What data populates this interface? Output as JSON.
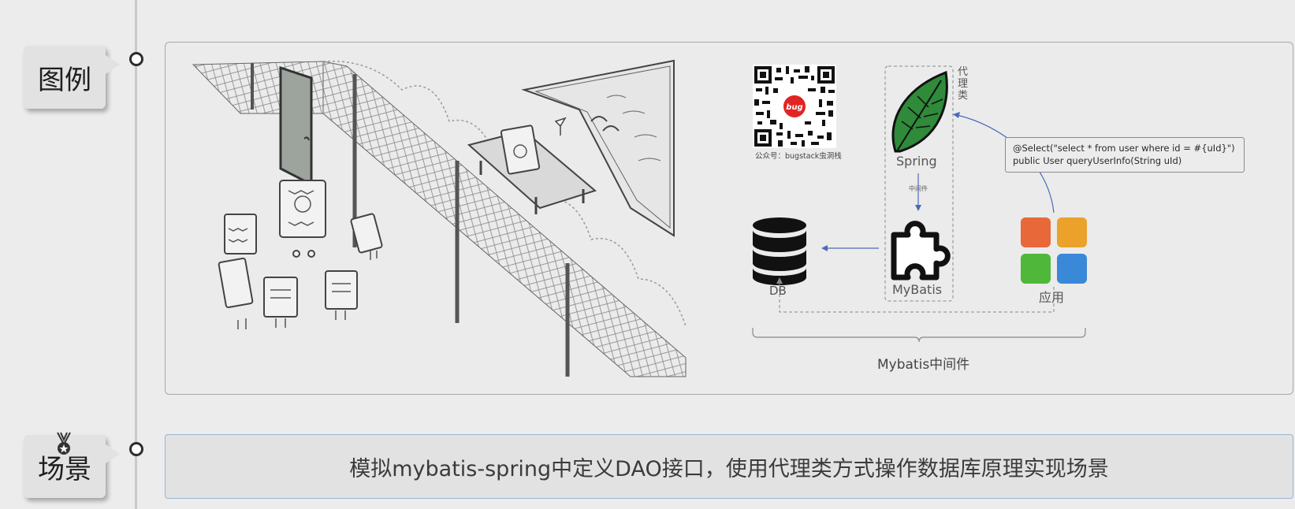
{
  "sections": {
    "legend_label": "图例",
    "scene_label": "场景"
  },
  "diagram": {
    "qr_caption": "公众号：bugstack虫洞栈",
    "qr_badge": "bug",
    "proxy_label": "代理类",
    "spring_label": "Spring",
    "middleware_small": "中间件",
    "mybatis_label": "MyBatis",
    "db_label": "DB",
    "app_label": "应用",
    "code_line1": "@Select(\"select * from user where id = #{uId}\")",
    "code_line2": "public User queryUserInfo(String uId)",
    "brace_label": "Mybatis中间件"
  },
  "scene": {
    "text": "模拟mybatis-spring中定义DAO接口，使用代理类方式操作数据库原理实现场景"
  },
  "colors": {
    "app_tiles": [
      "#e8683a",
      "#eaa22a",
      "#4fb83a",
      "#3a88d8"
    ],
    "spring_leaf": "#2f8a3a",
    "arrow": "#4a6ab8"
  }
}
